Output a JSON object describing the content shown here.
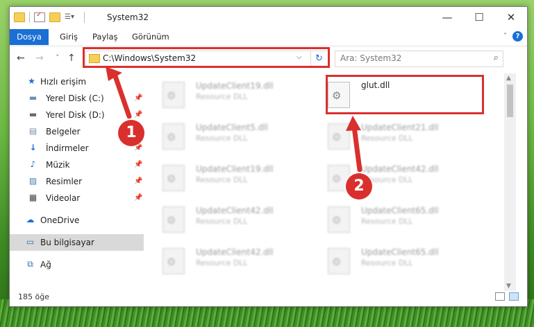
{
  "window": {
    "title": "System32",
    "controls": {
      "minimize": "—",
      "maximize": "☐",
      "close": "✕"
    }
  },
  "ribbon": {
    "tabs": [
      "Dosya",
      "Giriş",
      "Paylaş",
      "Görünüm"
    ],
    "help": "?"
  },
  "navigation": {
    "back": "←",
    "forward": "→",
    "recent": "˅",
    "up": "↑",
    "address": "C:\\Windows\\System32",
    "search_placeholder": "Ara: System32"
  },
  "sidebar": {
    "items": [
      {
        "label": "Hızlı erişim",
        "icon": "star-icon"
      },
      {
        "label": "Yerel Disk (C:)",
        "icon": "drive-icon",
        "pinned": true
      },
      {
        "label": "Yerel Disk (D:)",
        "icon": "drive-icon",
        "pinned": true
      },
      {
        "label": "Belgeler",
        "icon": "documents-icon",
        "pinned": true
      },
      {
        "label": "İndirmeler",
        "icon": "download-icon",
        "pinned": true
      },
      {
        "label": "Müzik",
        "icon": "music-icon",
        "pinned": true
      },
      {
        "label": "Resimler",
        "icon": "pictures-icon",
        "pinned": true
      },
      {
        "label": "Videolar",
        "icon": "videos-icon",
        "pinned": true
      },
      {
        "label": "OneDrive",
        "icon": "cloud-icon"
      },
      {
        "label": "Bu bilgisayar",
        "icon": "computer-icon",
        "selected": true
      },
      {
        "label": "Ağ",
        "icon": "network-icon"
      }
    ]
  },
  "files": [
    {
      "name": "UpdateClient19.dll",
      "type": "Resource DLL"
    },
    {
      "name": "glut.dll",
      "type": ""
    },
    {
      "name": "UpdateClient5.dll",
      "type": "Resource DLL"
    },
    {
      "name": "UpdateClient21.dll",
      "type": "Resource DLL"
    },
    {
      "name": "UpdateClient19.dll",
      "type": "Resource DLL"
    },
    {
      "name": "UpdateClient42.dll",
      "type": "Resource DLL"
    },
    {
      "name": "UpdateClient42.dll",
      "type": "Resource DLL"
    },
    {
      "name": "UpdateClient65.dll",
      "type": "Resource DLL"
    },
    {
      "name": "UpdateClient42.dll",
      "type": "Resource DLL"
    },
    {
      "name": "UpdateClient65.dll",
      "type": "Resource DLL"
    }
  ],
  "status": {
    "item_count": "185 öğe"
  },
  "callouts": [
    "1",
    "2"
  ],
  "colors": {
    "accent": "#1a6fd4",
    "highlight": "#d9302d"
  }
}
